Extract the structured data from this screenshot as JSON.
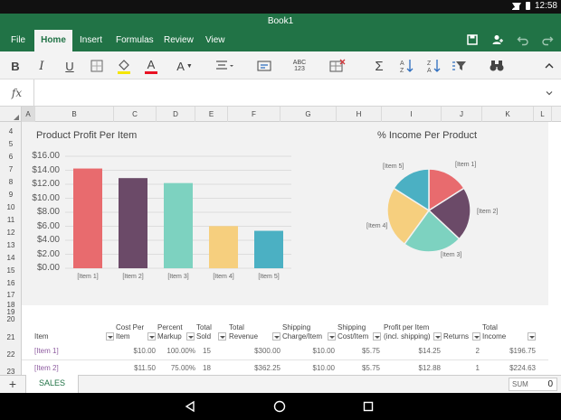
{
  "status": {
    "time": "12:58"
  },
  "document": {
    "title": "Book1"
  },
  "ribbon": {
    "tabs": [
      {
        "label": "File"
      },
      {
        "label": "Home"
      },
      {
        "label": "Insert"
      },
      {
        "label": "Formulas"
      },
      {
        "label": "Review"
      },
      {
        "label": "View"
      }
    ],
    "active_tab": "Home"
  },
  "toolbar": {
    "bold": "B",
    "italic": "I",
    "underline": "U",
    "font_color": "A",
    "font_size": "A",
    "number_format": "ABC\n123",
    "sum": "Σ"
  },
  "formula_bar": {
    "fx_label": "fx",
    "value": ""
  },
  "columns": [
    "A",
    "B",
    "C",
    "D",
    "E",
    "F",
    "G",
    "H",
    "I",
    "J",
    "K",
    "L"
  ],
  "rows": [
    "4",
    "5",
    "6",
    "7",
    "8",
    "9",
    "10",
    "11",
    "12",
    "13",
    "14",
    "15",
    "16",
    "17",
    "18",
    "19",
    "20",
    "21",
    "22",
    "23"
  ],
  "chart_data": [
    {
      "type": "bar",
      "title": "Product Profit Per Item",
      "categories": [
        "[Item 1]",
        "[Item 2]",
        "[Item 3]",
        "[Item 4]",
        "[Item 5]"
      ],
      "values": [
        14.25,
        12.88,
        12.17,
        6.02,
        5.35
      ],
      "colors": [
        "#e86b6e",
        "#6b4a68",
        "#7dd2c0",
        "#f6cf7e",
        "#4bb0c3"
      ],
      "yticks": [
        "$16.00",
        "$14.00",
        "$12.00",
        "$10.00",
        "$8.00",
        "$6.00",
        "$4.00",
        "$2.00",
        "$0.00"
      ],
      "ylim": [
        0,
        16
      ],
      "grid": true
    },
    {
      "type": "pie",
      "title": "% Income Per Product",
      "labels": [
        "[Item 1]",
        "[Item 2]",
        "[Item 3]",
        "[Item 4]",
        "[Item 5]"
      ],
      "values": [
        0.16,
        0.21,
        0.23,
        0.24,
        0.16
      ],
      "colors": [
        "#e86b6e",
        "#6b4a68",
        "#7dd2c0",
        "#f6cf7e",
        "#4bb0c3"
      ]
    }
  ],
  "table": {
    "headers": [
      "Item",
      "Cost Per\nItem",
      "Percent\nMarkup",
      "Total\nSold",
      "Total\nRevenue",
      "Shipping\nCharge/Item",
      "Shipping\nCost/Item",
      "Profit per Item\n(incl. shipping)",
      "Returns",
      "Total\nIncome"
    ],
    "rows": [
      [
        "[Item 1]",
        "$10.00",
        "100.00%",
        "15",
        "$300.00",
        "$10.00",
        "$5.75",
        "$14.25",
        "2",
        "$196.75"
      ],
      [
        "[Item 2]",
        "$11.50",
        "75.00%",
        "18",
        "$362.25",
        "$10.00",
        "$5.75",
        "$12.88",
        "1",
        "$224.63"
      ]
    ]
  },
  "sheets": {
    "add": "+",
    "active": "SALES"
  },
  "sum_box": {
    "label": "SUM",
    "value": "0"
  }
}
